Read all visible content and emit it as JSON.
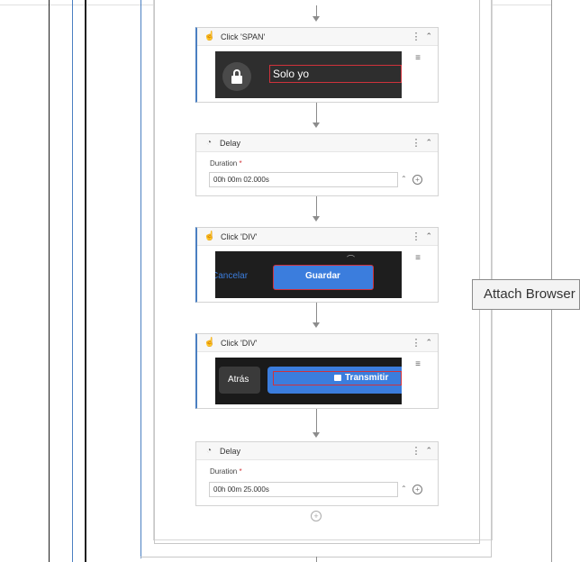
{
  "flow": {
    "steps": [
      {
        "type": "click",
        "title": "Click 'SPAN'",
        "screenshot": {
          "lock_icon": "lock-icon",
          "text": "Solo yo"
        }
      },
      {
        "type": "delay",
        "title": "Delay",
        "field_label": "Duration",
        "value": "00h 00m 02.000s"
      },
      {
        "type": "click",
        "title": "Click 'DIV'",
        "screenshot": {
          "cancel": "Cancelar",
          "save": "Guardar"
        }
      },
      {
        "type": "click",
        "title": "Click 'DIV'",
        "screenshot": {
          "back": "Atrás",
          "cast": "Transmitir"
        }
      },
      {
        "type": "delay",
        "title": "Delay",
        "field_label": "Duration",
        "value": "00h 00m 25.000s"
      }
    ],
    "required_mark": "*"
  },
  "tooltip": {
    "text": "Attach Browser"
  },
  "colors": {
    "accent": "#4a7fc1",
    "highlight_border": "#d0323c",
    "dark_bg": "#2b2b2b",
    "save_blue": "#3b7ddd"
  }
}
